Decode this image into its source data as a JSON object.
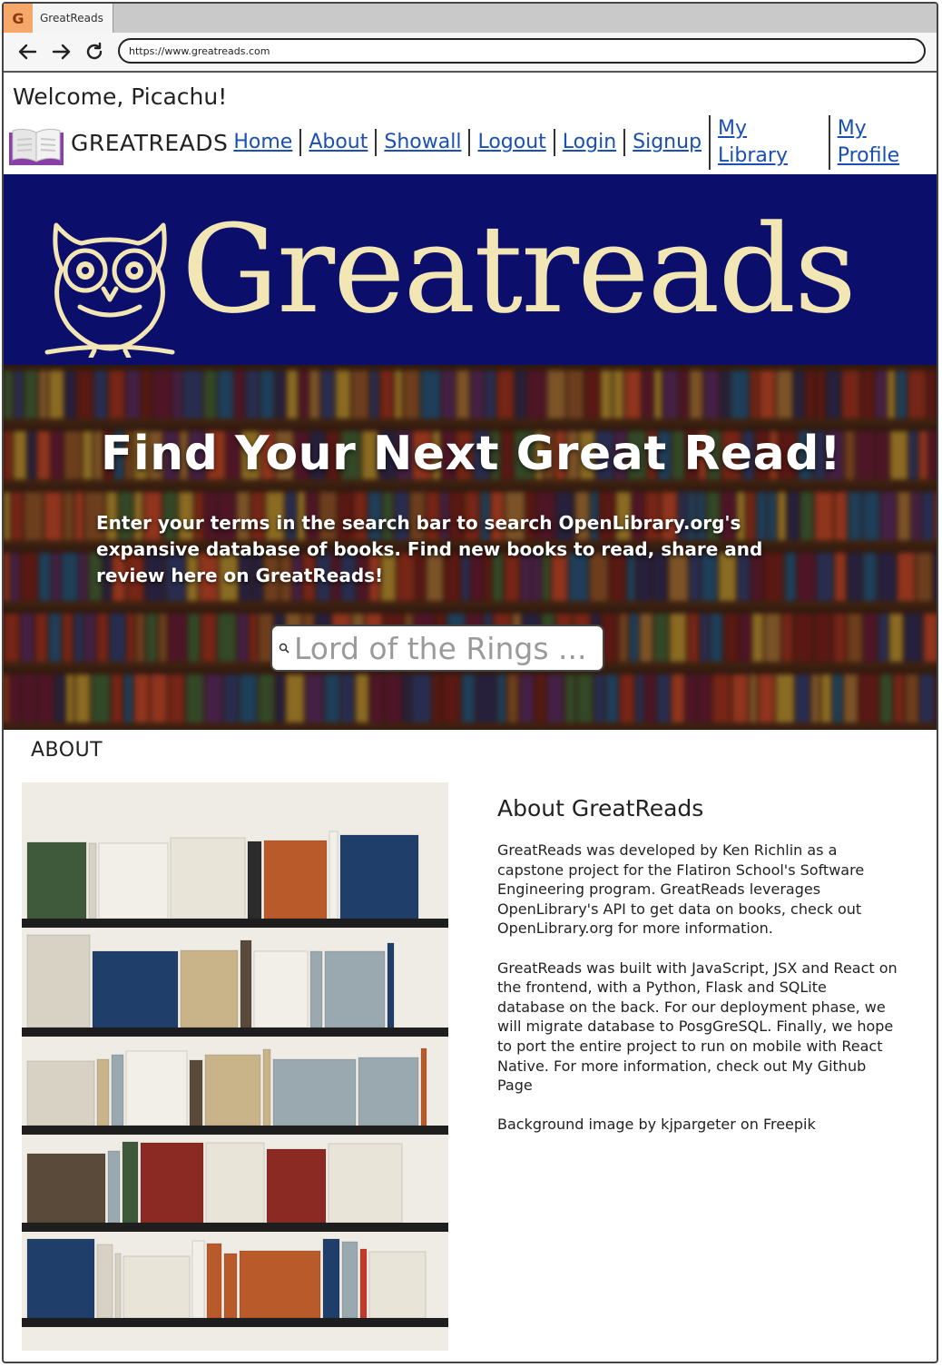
{
  "browser": {
    "tab_title": "GreatReads",
    "favicon_letter": "G",
    "url": "https://www.greatreads.com"
  },
  "welcome": "Welcome, Picachu!",
  "nav": {
    "brand": "GREATREADS",
    "links": [
      "Home",
      "About",
      "Showall",
      "Logout",
      "Login",
      "Signup",
      "My Library",
      "My Profile"
    ]
  },
  "banner": {
    "logo_text": "Greatreads"
  },
  "hero": {
    "title": "Find Your Next Great Read!",
    "description": "Enter your terms in the search bar to search OpenLibrary.org's expansive database of books.  Find new books to read, share and review here on GreatReads!",
    "search_placeholder": "Lord of the Rings ..."
  },
  "about": {
    "heading": "ABOUT",
    "title": "About GreatReads",
    "paragraphs": [
      "GreatReads was developed by Ken Richlin as a capstone project for the Flatiron School's Software Engineering program. GreatReads leverages OpenLibrary's API to get data on books, check out OpenLibrary.org for more information.",
      "GreatReads was built with JavaScript, JSX and React on the frontend, with a Python, Flask and SQLite database on the back. For our deployment phase, we will migrate database to PosgGreSQL. Finally, we hope to port the entire project to run on mobile with React Native. For more information, check out My Github Page",
      "Background image by kjpargeter on Freepik"
    ]
  },
  "colors": {
    "banner_bg": "#0b0e6b",
    "banner_text": "#f2e6b4",
    "link": "#1a4fb3",
    "hero_bg": "#3a1f12"
  }
}
